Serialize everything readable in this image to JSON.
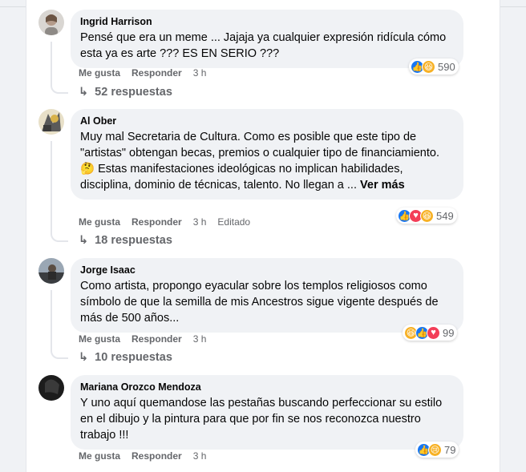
{
  "comments": [
    {
      "author": "Ingrid Harrison",
      "text": "Pensé que era un meme ... Jajaja ya cualquier expresión ridícula cómo esta ya es arte ??? ES EN SERIO ???",
      "like": "Me gusta",
      "reply": "Responder",
      "time": "3 h",
      "reaction_count": "590",
      "reaction_icons": [
        "like-icon",
        "haha-icon"
      ],
      "replies": "52 respuestas"
    },
    {
      "author": "Al Ober",
      "text": "Muy mal Secretaria de Cultura. Como es posible que este tipo de \"artistas\" obtengan becas, premios o cualquier tipo de financiamiento.🤔 Estas manifestaciones ideológicas no implican habilidades, disciplina, dominio de técnicas, talento. No llegan a ...",
      "see_more": "Ver más",
      "like": "Me gusta",
      "reply": "Responder",
      "time": "3 h",
      "edited": "Editado",
      "reaction_count": "549",
      "reaction_icons": [
        "like-icon",
        "love-icon",
        "haha-icon"
      ],
      "replies": "18 respuestas"
    },
    {
      "author": "Jorge Isaac",
      "text": "Como artista, propongo eyacular sobre los templos religiosos como símbolo de que la semilla de mis Ancestros sigue vigente después de más de 500 años...",
      "like": "Me gusta",
      "reply": "Responder",
      "time": "3 h",
      "reaction_count": "99",
      "reaction_icons": [
        "haha-icon",
        "like-icon",
        "love-icon"
      ],
      "replies": "10 respuestas"
    },
    {
      "author": "Mariana Orozco Mendoza",
      "text": "Y uno aquí quemandose las pestañas buscando perfeccionar su estilo en el dibujo y la pintura para que por fin se nos reconozca nuestro trabajo !!!",
      "like": "Me gusta",
      "reply": "Responder",
      "time": "3 h",
      "reaction_count": "79",
      "reaction_icons": [
        "like-icon",
        "sad-icon"
      ]
    }
  ],
  "colors": {
    "bubble": "#f0f2f5",
    "meta": "#65676b",
    "like": "#1877f2",
    "love": "#f33e58",
    "haha": "#f7b125"
  }
}
